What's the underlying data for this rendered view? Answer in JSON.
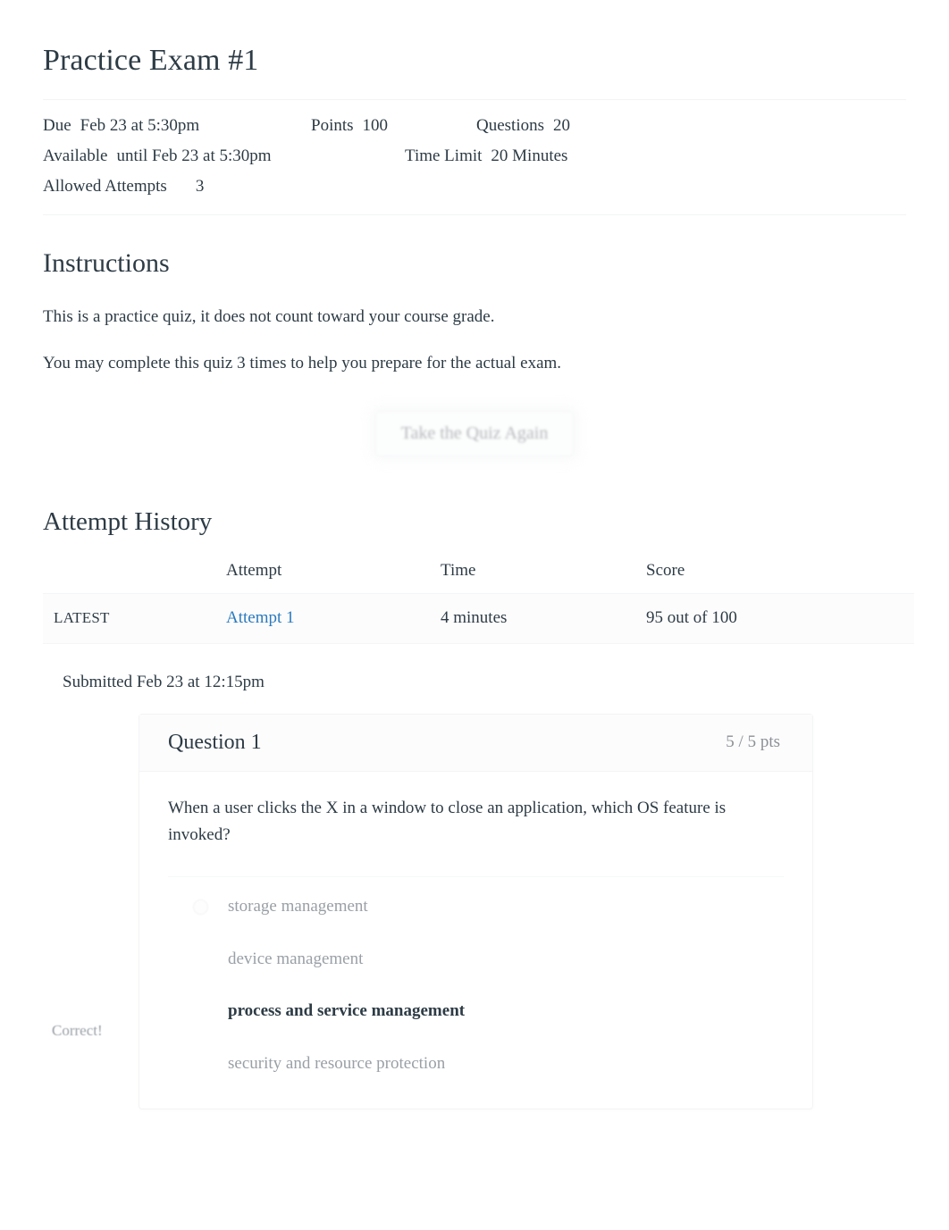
{
  "quiz": {
    "title": "Practice Exam #1",
    "meta": {
      "due_label": "Due",
      "due_value": "Feb 23 at 5:30pm",
      "points_label": "Points",
      "points_value": "100",
      "questions_label": "Questions",
      "questions_value": "20",
      "available_label": "Available",
      "available_value": "until Feb 23 at 5:30pm",
      "time_limit_label": "Time Limit",
      "time_limit_value": "20 Minutes",
      "allowed_attempts_label": "Allowed Attempts",
      "allowed_attempts_value": "3"
    }
  },
  "instructions": {
    "heading": "Instructions",
    "paragraph_1": "This is a practice quiz, it does not count toward your course grade.",
    "paragraph_2": "You may complete this quiz 3 times to help you prepare for the actual exam."
  },
  "actions": {
    "take_quiz_again": "Take the Quiz Again"
  },
  "attempt_history": {
    "heading": "Attempt History",
    "columns": [
      "",
      "Attempt",
      "Time",
      "Score"
    ],
    "rows": [
      {
        "badge": "LATEST",
        "attempt": "Attempt 1",
        "time": "4 minutes",
        "score": "95 out of 100"
      }
    ]
  },
  "submission": {
    "submitted_line": "Submitted Feb 23 at 12:15pm"
  },
  "questions": [
    {
      "name": "Question 1",
      "points": "5 / 5 pts",
      "correct_flag": "Correct!",
      "text": "When a user clicks the X in a window to close an application, which OS feature is invoked?",
      "answers": [
        {
          "label": "storage management",
          "selected": false
        },
        {
          "label": "device management",
          "selected": false
        },
        {
          "label": "process and service management",
          "selected": true
        },
        {
          "label": "security and resource protection",
          "selected": false
        }
      ]
    }
  ],
  "colors": {
    "link": "#2b7abc",
    "text": "#2d3b45",
    "muted": "#9aa0a6",
    "card_border": "#f3f4f6"
  }
}
